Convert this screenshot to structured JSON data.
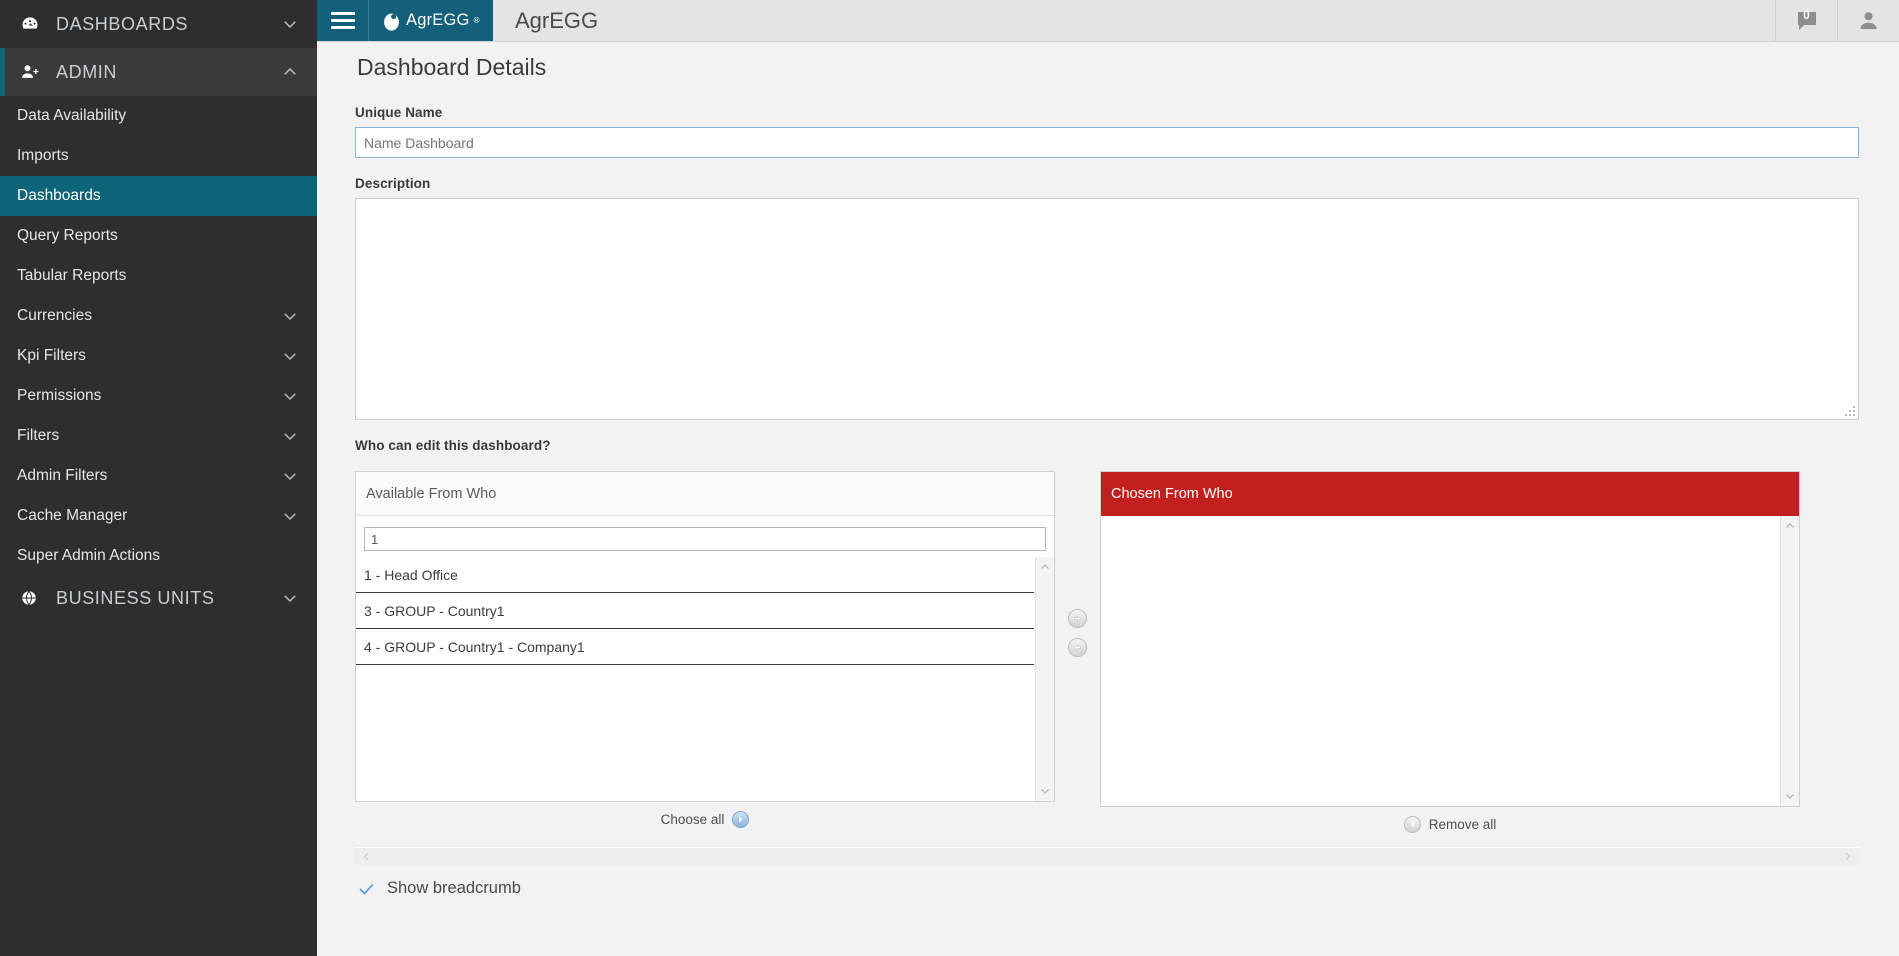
{
  "sidebar": {
    "groups": [
      {
        "label": "DASHBOARDS",
        "icon": "gauge-icon",
        "expanded": false,
        "active": false
      },
      {
        "label": "ADMIN",
        "icon": "user-add-icon",
        "expanded": true,
        "active": true
      }
    ],
    "items": [
      {
        "label": "Data Availability",
        "selected": false,
        "expandable": false
      },
      {
        "label": "Imports",
        "selected": false,
        "expandable": false
      },
      {
        "label": "Dashboards",
        "selected": true,
        "expandable": false
      },
      {
        "label": "Query Reports",
        "selected": false,
        "expandable": false
      },
      {
        "label": "Tabular Reports",
        "selected": false,
        "expandable": false
      },
      {
        "label": "Currencies",
        "selected": false,
        "expandable": true
      },
      {
        "label": "Kpi Filters",
        "selected": false,
        "expandable": true
      },
      {
        "label": "Permissions",
        "selected": false,
        "expandable": true
      },
      {
        "label": "Filters",
        "selected": false,
        "expandable": true
      },
      {
        "label": "Admin Filters",
        "selected": false,
        "expandable": true
      },
      {
        "label": "Cache Manager",
        "selected": false,
        "expandable": true
      },
      {
        "label": "Super Admin Actions",
        "selected": false,
        "expandable": false
      }
    ],
    "footer_group": {
      "label": "BUSINESS UNITS",
      "icon": "globe-icon",
      "expandable": true
    }
  },
  "topbar": {
    "menu_icon": "hamburger-icon",
    "brand_text": "AgrEGG",
    "brand_superscript": "®",
    "brand_icon": "egg-logo-icon",
    "app_title": "AgrEGG",
    "notification_icon": "speech-bubble-icon",
    "notification_count": "0",
    "user_icon": "user-avatar-icon"
  },
  "page": {
    "title": "Dashboard Details",
    "unique_name": {
      "label": "Unique Name",
      "value": "",
      "placeholder": "Name Dashboard"
    },
    "description": {
      "label": "Description",
      "value": "",
      "placeholder": ""
    },
    "edit_permission": {
      "question": "Who can edit this dashboard?",
      "available": {
        "header": "Available From Who",
        "filter_value": "1",
        "filter_placeholder": "",
        "items": [
          "1 - Head Office",
          "3 - GROUP - Country1",
          "4 - GROUP - Country1 - Company1"
        ],
        "choose_all_label": "Choose all",
        "choose_all_icon": "arrow-right-circle-icon"
      },
      "chosen": {
        "header": "Chosen From Who",
        "header_color": "#c1201f",
        "items": [],
        "remove_all_label": "Remove all",
        "remove_all_icon": "arrow-left-circle-icon"
      },
      "move_right_icon": "arrow-right-circle-icon",
      "move_left_icon": "arrow-left-circle-icon"
    },
    "show_breadcrumb": {
      "label": "Show breadcrumb",
      "checked": true,
      "icon": "check-icon"
    },
    "hscroll": {
      "left_icon": "chevron-left-icon",
      "right_icon": "chevron-right-icon"
    }
  },
  "colors": {
    "teal": "#14607a",
    "sidebar_bg": "#2e2e2e",
    "selected": "#0d6377",
    "red": "#c1201f",
    "accent_blue": "#5b9bd5"
  }
}
